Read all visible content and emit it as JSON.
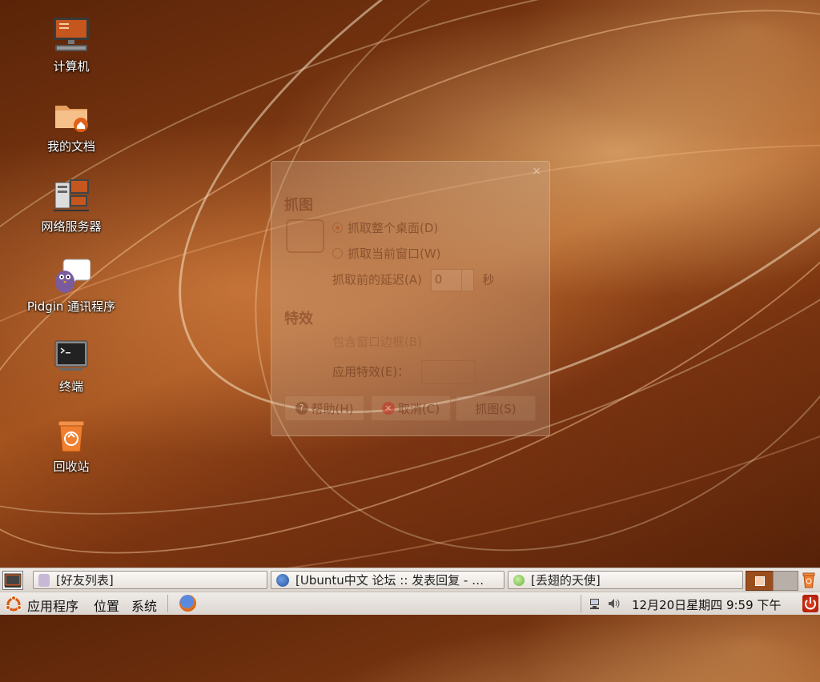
{
  "desktop": {
    "icons": [
      {
        "label": "计算机",
        "icon": "computer-icon"
      },
      {
        "label": "我的文档",
        "icon": "home-folder-icon"
      },
      {
        "label": "网络服务器",
        "icon": "network-servers-icon"
      },
      {
        "label": "Pidgin 通讯程序",
        "icon": "pidgin-icon"
      },
      {
        "label": "终端",
        "icon": "terminal-icon"
      },
      {
        "label": "回收站",
        "icon": "trash-icon"
      }
    ]
  },
  "dialog": {
    "close": "×",
    "section_grab": "抓图",
    "option_desktop": "抓取整个桌面(D)",
    "option_window": "抓取当前窗口(W)",
    "delay_label": "抓取前的延迟(A)",
    "delay_value": "0",
    "delay_unit": "秒",
    "section_effects": "特效",
    "option_border": "包含窗口边框(B)",
    "apply_effect_label": "应用特效(E)：",
    "btn_help": "帮助(H)",
    "btn_cancel": "取消(C)",
    "btn_grab": "抓图(S)"
  },
  "taskbar": {
    "tasks": [
      {
        "label": "[好友列表]",
        "icon": "pidgin-buddy-icon"
      },
      {
        "label": "[Ubuntu中文 论坛 :: 发表回复 - …",
        "icon": "firefox-icon"
      },
      {
        "label": "[丢翅的天使]",
        "icon": "status-available-icon"
      }
    ]
  },
  "panel": {
    "menu_applications": "应用程序",
    "menu_places": "位置",
    "menu_system": "系统",
    "clock": "12月20日星期四  9:59 下午"
  },
  "colors": {
    "accent": "#e0701c",
    "panel_bg": "#e6e0da"
  }
}
